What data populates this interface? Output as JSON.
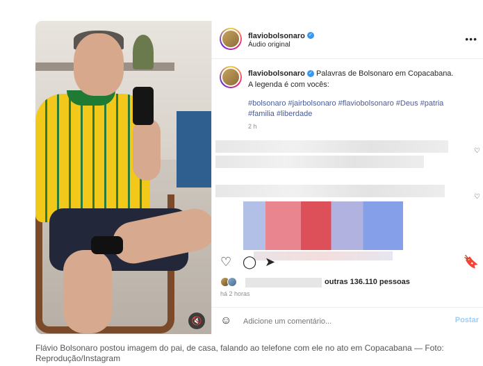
{
  "post": {
    "header": {
      "username": "flaviobolsonaro",
      "audio_label": "Áudio original",
      "more_icon": "more-horizontal-icon"
    },
    "caption": {
      "username": "flaviobolsonaro",
      "text": "Palavras de Bolsonaro em Copacabana. A legenda é com vocês:",
      "hashtags": "#bolsonaro #jairbolsonaro #flaviobolsonaro #Deus #patria #familia #liberdade",
      "time": "2 h"
    },
    "likes": {
      "text": "outras 136.110 pessoas"
    },
    "posted": "há 2 horas",
    "composer": {
      "placeholder": "Adicione um comentário...",
      "post_label": "Postar"
    }
  },
  "footer": {
    "caption": "Flávio Bolsonaro postou imagem do pai, de casa, falando ao telefone com ele no ato em Copacabana — Foto: Reprodução/Instagram"
  },
  "colors": {
    "verified": "#3897f0",
    "hashtag": "#4a5a9a",
    "post_button": "#9ccdf5"
  }
}
